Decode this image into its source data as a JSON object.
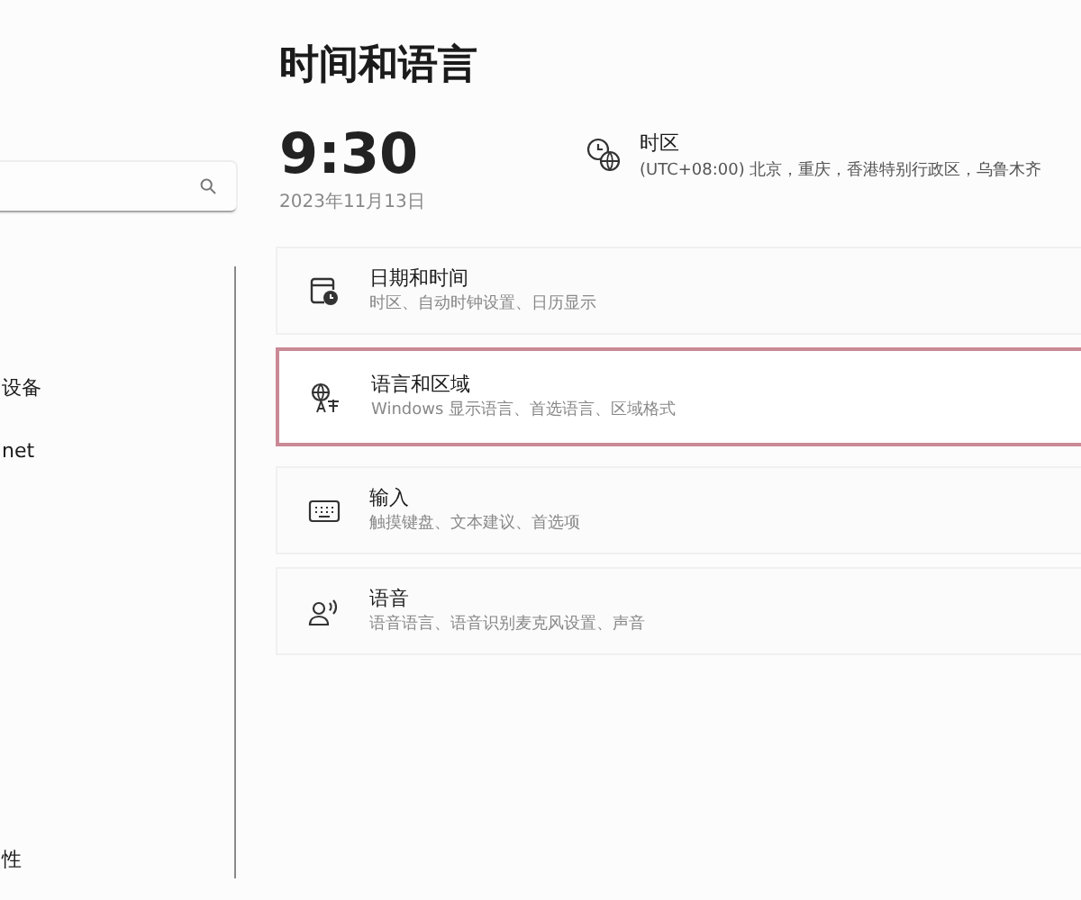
{
  "sidebar": {
    "items": [
      {
        "label": "设备"
      },
      {
        "label": "net"
      },
      {
        "label": "性"
      }
    ]
  },
  "page": {
    "title": "时间和语言"
  },
  "clock": {
    "time": "9:30",
    "date": "2023年11月13日"
  },
  "timezone": {
    "label": "时区",
    "value": "(UTC+08:00) 北京，重庆，香港特别行政区，乌鲁木齐"
  },
  "cards": [
    {
      "kind": "datetime",
      "title": "日期和时间",
      "subtitle": "时区、自动时钟设置、日历显示",
      "selected": false
    },
    {
      "kind": "language",
      "title": "语言和区域",
      "subtitle": "Windows 显示语言、首选语言、区域格式",
      "selected": true
    },
    {
      "kind": "keyboard",
      "title": "输入",
      "subtitle": "触摸键盘、文本建议、首选项",
      "selected": false
    },
    {
      "kind": "speech",
      "title": "语音",
      "subtitle": "语音语言、语音识别麦克风设置、声音",
      "selected": false
    }
  ]
}
